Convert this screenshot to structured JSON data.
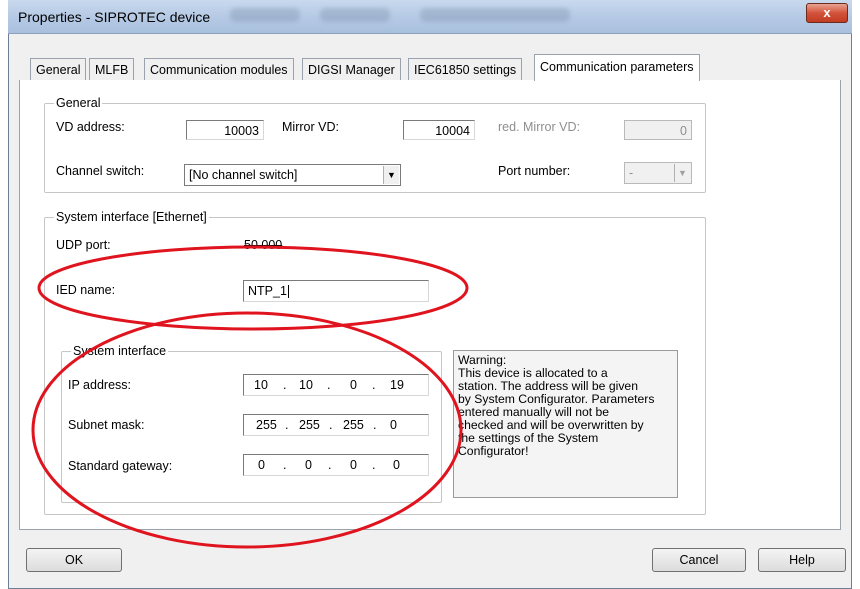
{
  "window": {
    "title": "Properties - SIPROTEC device",
    "close_label": "x"
  },
  "tabs": [
    {
      "label": "General"
    },
    {
      "label": "MLFB"
    },
    {
      "label": "Communication modules"
    },
    {
      "label": "DIGSI Manager"
    },
    {
      "label": "IEC61850 settings"
    },
    {
      "label": "Communication parameters"
    }
  ],
  "general": {
    "legend": "General",
    "vd_address_label": "VD address:",
    "vd_address_value": "10003",
    "mirror_vd_label": "Mirror VD:",
    "mirror_vd_value": "10004",
    "red_mirror_label": "red. Mirror VD:",
    "red_mirror_value": "0",
    "channel_switch_label": "Channel switch:",
    "channel_switch_value": "[No channel switch]",
    "port_number_label": "Port number:",
    "port_number_value": "-"
  },
  "system_interface_ethernet": {
    "legend": "System interface [Ethernet]",
    "udp_port_label": "UDP port:",
    "udp_port_value": "50 000",
    "ied_name_label": "IED name:",
    "ied_name_value": "NTP_1"
  },
  "system_interface": {
    "legend": "System interface",
    "ip_label": "IP address:",
    "ip": [
      "10",
      "10",
      "0",
      "19"
    ],
    "subnet_label": "Subnet mask:",
    "subnet": [
      "255",
      "255",
      "255",
      "0"
    ],
    "gateway_label": "Standard gateway:",
    "gateway": [
      "0",
      "0",
      "0",
      "0"
    ],
    "octet_separator": "."
  },
  "warning": {
    "text": "Warning:\nThis device is allocated to a\nstation. The address will be given\nby System Configurator. Parameters\nentered manually will not be\nchecked and will be overwritten by\nthe settings of the System\nConfigurator!"
  },
  "buttons": {
    "ok": "OK",
    "cancel": "Cancel",
    "help": "Help"
  },
  "colors": {
    "annotation_red": "#e0141e",
    "title_gradient_top": "#c9d9ee",
    "close_button_red": "#d2533a"
  },
  "icons": {
    "close": "close-icon",
    "dropdown": "chevron-down-icon"
  }
}
